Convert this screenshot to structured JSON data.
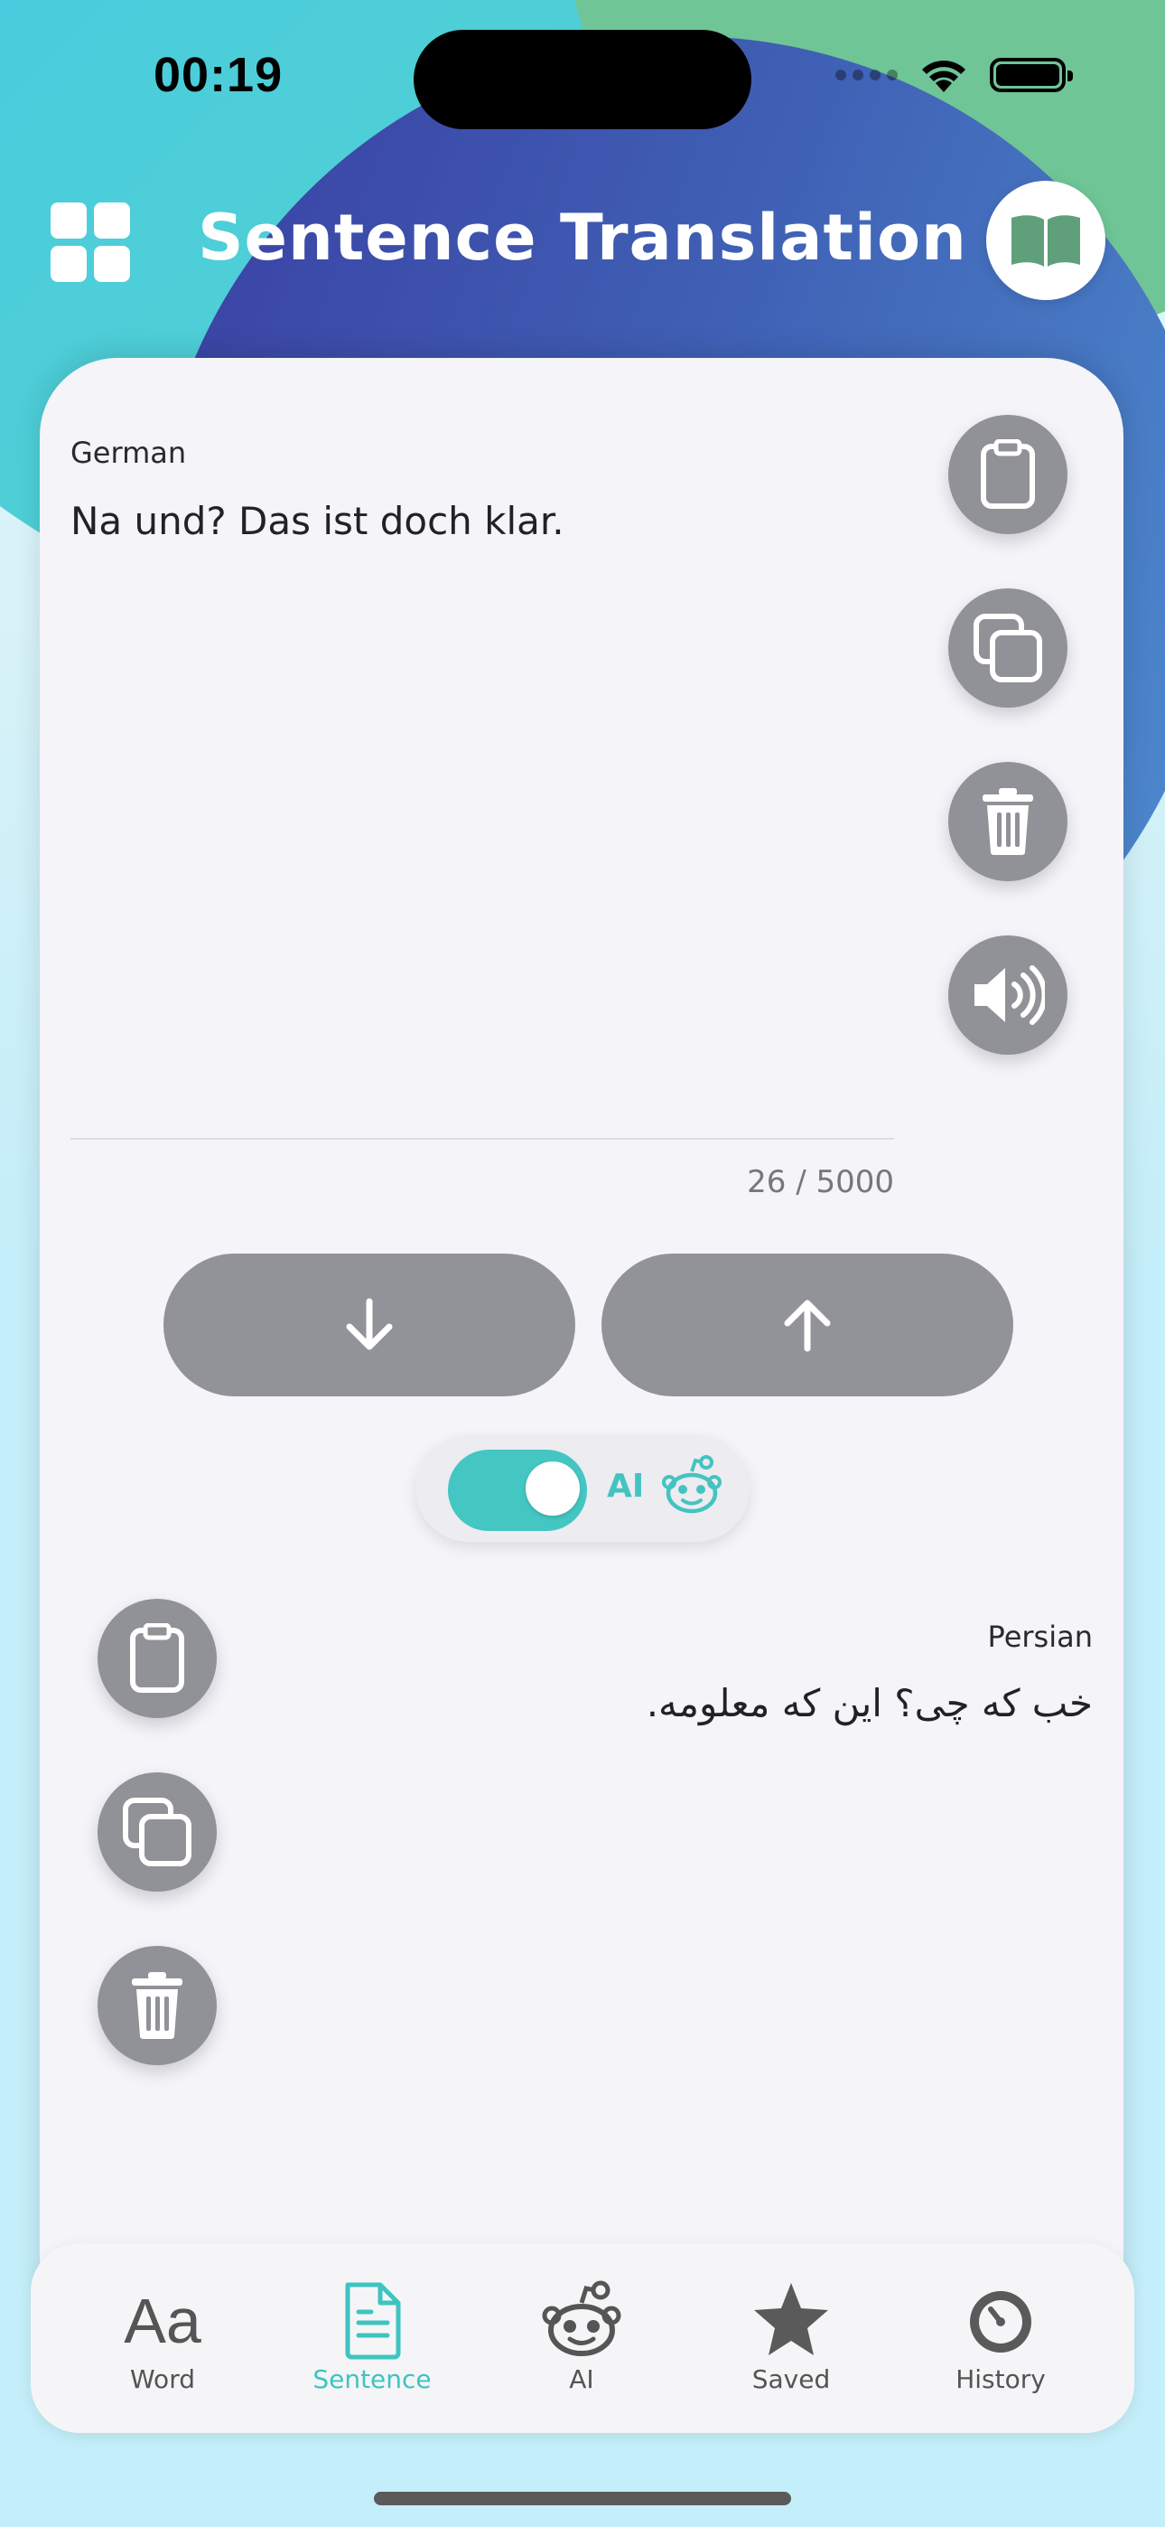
{
  "status_bar": {
    "time": "00:19"
  },
  "header": {
    "title": "Sentence Translation"
  },
  "source": {
    "language": "German",
    "text": "Na und? Das ist doch klar.",
    "counter": "26 / 5000"
  },
  "toggle": {
    "label": "AI",
    "on": true
  },
  "target": {
    "language": "Persian",
    "text": "خب که چی؟ این که معلومه."
  },
  "tabs": [
    {
      "label": "Word",
      "icon": "word-icon",
      "active": false
    },
    {
      "label": "Sentence",
      "icon": "document-icon",
      "active": true
    },
    {
      "label": "AI",
      "icon": "robot-icon",
      "active": false
    },
    {
      "label": "Saved",
      "icon": "star-icon",
      "active": false
    },
    {
      "label": "History",
      "icon": "history-icon",
      "active": false
    }
  ],
  "colors": {
    "accent": "#44c6c2",
    "button_gray": "#909297",
    "card": "#f4f4f9"
  }
}
